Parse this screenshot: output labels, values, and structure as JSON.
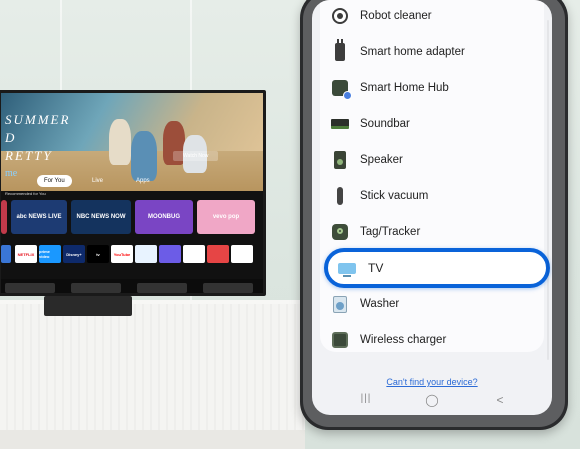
{
  "tv": {
    "hero_title_lines": [
      "SUMMER",
      "D",
      "RETTY"
    ],
    "hero_subtitle": "me",
    "watch_label": "Watch Now",
    "tabs": [
      "For You",
      "Live",
      "Apps"
    ],
    "recommended_label": "Recommended for You",
    "cards": [
      "abc NEWS LIVE",
      "NBC NEWS NOW",
      "MOONBUG",
      "vevo pop"
    ],
    "apps": [
      "NETFLIX",
      "prime video",
      "Disney+",
      "tv",
      "YouTube",
      "",
      "",
      "",
      "",
      "",
      ""
    ]
  },
  "phone": {
    "devices": [
      {
        "label": "Robot cleaner",
        "icon": "robot-cleaner-icon"
      },
      {
        "label": "Smart home adapter",
        "icon": "smart-home-adapter-icon"
      },
      {
        "label": "Smart Home Hub",
        "icon": "smart-home-hub-icon"
      },
      {
        "label": "Soundbar",
        "icon": "soundbar-icon"
      },
      {
        "label": "Speaker",
        "icon": "speaker-icon"
      },
      {
        "label": "Stick vacuum",
        "icon": "stick-vacuum-icon"
      },
      {
        "label": "Tag/Tracker",
        "icon": "tag-tracker-icon"
      },
      {
        "label": "TV",
        "icon": "tv-icon",
        "selected": true
      },
      {
        "label": "Washer",
        "icon": "washer-icon"
      },
      {
        "label": "Wireless charger",
        "icon": "wireless-charger-icon"
      }
    ],
    "cant_find_link": "Can't find your device?",
    "nav": {
      "recents": "|||",
      "home": "◯",
      "back": "<"
    },
    "accent_color": "#0a63d9"
  }
}
